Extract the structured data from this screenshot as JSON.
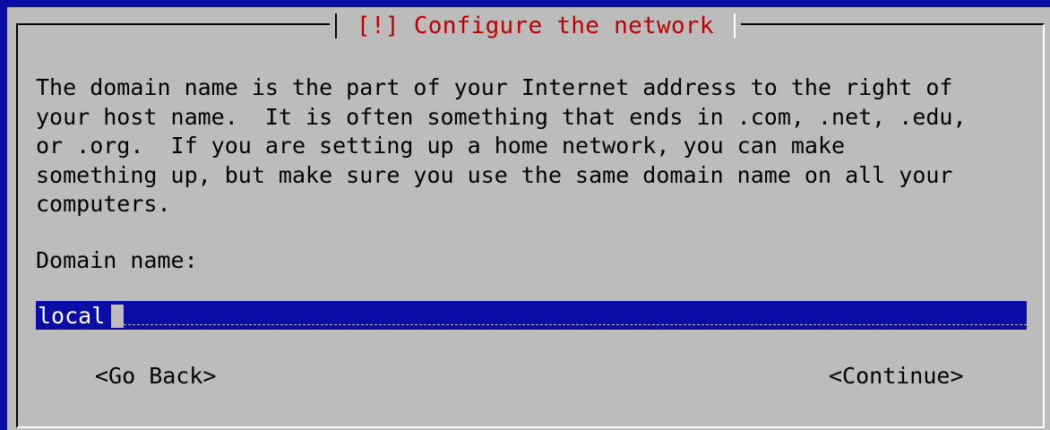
{
  "dialog": {
    "title": "[!] Configure the network",
    "description_lines": [
      "The domain name is the part of your Internet address to the right of",
      "your host name.  It is often something that ends in .com, .net, .edu,",
      "or .org.  If you are setting up a home network, you can make",
      "something up, but make sure you use the same domain name on all your",
      "computers."
    ],
    "field_label": "Domain name:",
    "field_value": "local",
    "buttons": {
      "back": "<Go Back>",
      "continue": "<Continue>"
    }
  },
  "colors": {
    "background": "#0c0ca6",
    "dialog": "#bcbcbc",
    "title": "#c00000",
    "field": "#0c0ca6"
  }
}
